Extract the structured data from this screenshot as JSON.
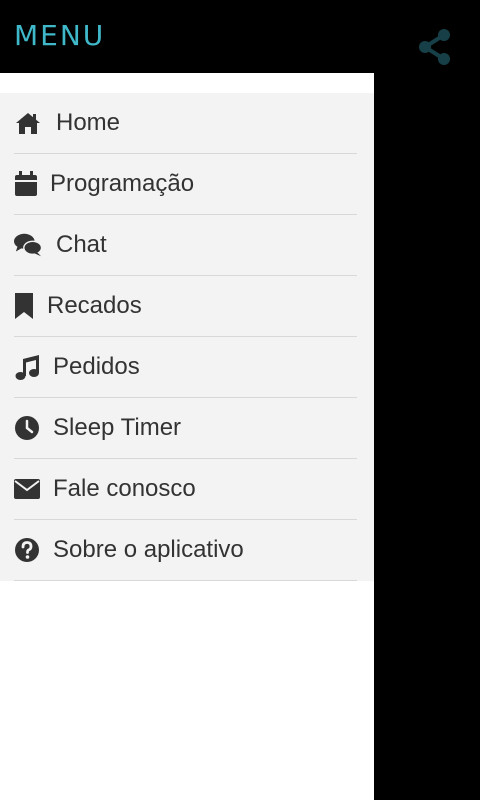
{
  "header": {
    "title": "MENU",
    "share_icon": "share-icon",
    "accent_color": "#3fb8c9",
    "share_color": "#173f48"
  },
  "menu": {
    "items": [
      {
        "label": "Home",
        "icon": "home-icon"
      },
      {
        "label": "Programação",
        "icon": "calendar-icon"
      },
      {
        "label": "Chat",
        "icon": "chat-icon"
      },
      {
        "label": "Recados",
        "icon": "bookmark-icon"
      },
      {
        "label": "Pedidos",
        "icon": "music-note-icon"
      },
      {
        "label": "Sleep Timer",
        "icon": "clock-icon"
      },
      {
        "label": "Fale conosco",
        "icon": "envelope-icon"
      },
      {
        "label": "Sobre o aplicativo",
        "icon": "question-circle-icon"
      }
    ]
  }
}
